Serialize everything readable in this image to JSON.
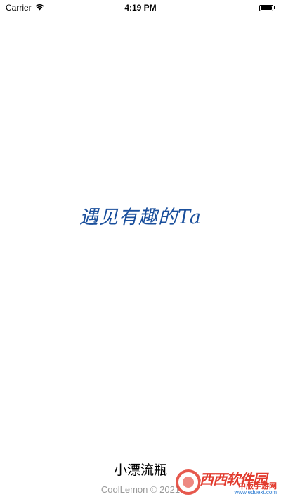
{
  "status_bar": {
    "carrier": "Carrier",
    "time": "4:19 PM",
    "battery_level": 1.0,
    "icons": [
      "wifi-icon",
      "battery-icon"
    ]
  },
  "splash": {
    "slogan": "遇见有趣的Ta"
  },
  "footer": {
    "app_name": "小漂流瓶",
    "copyright": "CoolLemon © 2021"
  },
  "watermark": {
    "main": "西西软件园",
    "sub": "中版手游网",
    "url": "www.eduext.com"
  },
  "colors": {
    "slogan": "#1a4f9c",
    "copyright": "#9a9a9a",
    "watermark": "#e23b2e"
  }
}
